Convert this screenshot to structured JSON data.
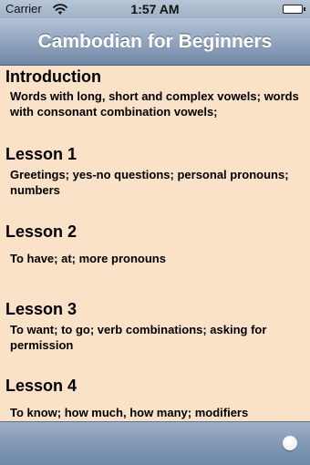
{
  "status_bar": {
    "carrier": "Carrier",
    "time": "1:57 AM",
    "wifi_icon": "wifi-icon",
    "battery_icon": "battery-icon"
  },
  "nav": {
    "title": "Cambodian for Beginners"
  },
  "lessons": [
    {
      "title": "Introduction",
      "description": "Words with long, short and complex vowels; words with consonant combination vowels;"
    },
    {
      "title": "Lesson 1",
      "description": "Greetings; yes-no questions; personal pronouns; numbers"
    },
    {
      "title": "Lesson 2",
      "description": "To have; at; more pronouns"
    },
    {
      "title": "Lesson 3",
      "description": "To want; to go; verb combinations; asking for permission"
    },
    {
      "title": "Lesson 4",
      "description": "To know; how much, how many; modifiers"
    }
  ],
  "toolbar": {
    "button_icon": "circle-icon"
  },
  "colors": {
    "background": "#f9e2c8",
    "nav_bar": "#8da2bb",
    "toolbar": "#8199b5"
  }
}
